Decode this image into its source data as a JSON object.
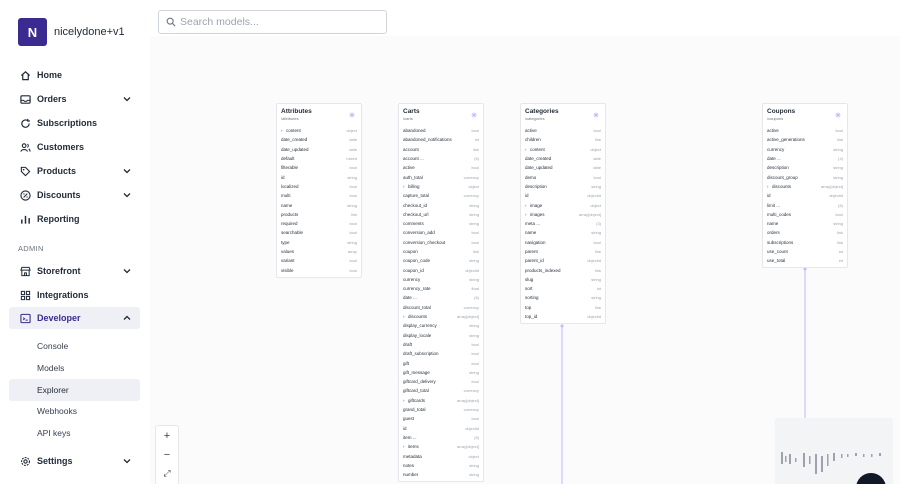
{
  "store": {
    "initial": "N",
    "name": "nicelydone+v1"
  },
  "search": {
    "placeholder": "Search models..."
  },
  "nav": {
    "home": "Home",
    "orders": "Orders",
    "subscriptions": "Subscriptions",
    "customers": "Customers",
    "products": "Products",
    "discounts": "Discounts",
    "reporting": "Reporting",
    "admin_label": "ADMIN",
    "storefront": "Storefront",
    "integrations": "Integrations",
    "developer": "Developer",
    "developer_items": [
      "Console",
      "Models",
      "Explorer",
      "Webhooks",
      "API keys"
    ],
    "settings": "Settings"
  },
  "colors": {
    "brand": "#3b2a8f",
    "link_line": "#c4b5fd"
  },
  "models": [
    {
      "title": "Attributes",
      "path": "/attributes",
      "fields": [
        {
          "name": "content",
          "type": "object",
          "expand": true
        },
        {
          "name": "date_created",
          "type": "date"
        },
        {
          "name": "date_updated",
          "type": "date"
        },
        {
          "name": "default",
          "type": "mixed"
        },
        {
          "name": "filterable",
          "type": "bool"
        },
        {
          "name": "id",
          "type": "string"
        },
        {
          "name": "localized",
          "type": "bool"
        },
        {
          "name": "multi",
          "type": "bool"
        },
        {
          "name": "name",
          "type": "string"
        },
        {
          "name": "products",
          "type": "link"
        },
        {
          "name": "required",
          "type": "bool"
        },
        {
          "name": "searchable",
          "type": "bool"
        },
        {
          "name": "type",
          "type": "string"
        },
        {
          "name": "values",
          "type": "array"
        },
        {
          "name": "variant",
          "type": "bool"
        },
        {
          "name": "visible",
          "type": "bool"
        }
      ]
    },
    {
      "title": "Carts",
      "path": "/carts",
      "fields": [
        {
          "name": "abandoned",
          "type": "bool"
        },
        {
          "name": "abandoned_notifications",
          "type": "int"
        },
        {
          "name": "account",
          "type": "link"
        },
        {
          "name": "account ...",
          "type": "(5)"
        },
        {
          "name": "active",
          "type": "bool"
        },
        {
          "name": "auth_total",
          "type": "currency"
        },
        {
          "name": "billing",
          "type": "object",
          "expand": true
        },
        {
          "name": "capture_total",
          "type": "currency"
        },
        {
          "name": "checkout_id",
          "type": "string"
        },
        {
          "name": "checkout_url",
          "type": "string"
        },
        {
          "name": "comments",
          "type": "string"
        },
        {
          "name": "conversion_add",
          "type": "bool"
        },
        {
          "name": "conversion_checkout",
          "type": "bool"
        },
        {
          "name": "coupon",
          "type": "link"
        },
        {
          "name": "coupon_code",
          "type": "string"
        },
        {
          "name": "coupon_id",
          "type": "objectid"
        },
        {
          "name": "currency",
          "type": "string"
        },
        {
          "name": "currency_rate",
          "type": "float"
        },
        {
          "name": "date ...",
          "type": "(6)"
        },
        {
          "name": "discount_total",
          "type": "currency"
        },
        {
          "name": "discounts",
          "type": "array[object]",
          "expand": true
        },
        {
          "name": "display_currency",
          "type": "string"
        },
        {
          "name": "display_locale",
          "type": "string"
        },
        {
          "name": "draft",
          "type": "bool"
        },
        {
          "name": "draft_subscription",
          "type": "bool"
        },
        {
          "name": "gift",
          "type": "bool"
        },
        {
          "name": "gift_message",
          "type": "string"
        },
        {
          "name": "giftcard_delivery",
          "type": "bool"
        },
        {
          "name": "giftcard_total",
          "type": "currency"
        },
        {
          "name": "giftcards",
          "type": "array[object]",
          "expand": true
        },
        {
          "name": "grand_total",
          "type": "currency"
        },
        {
          "name": "guest",
          "type": "bool"
        },
        {
          "name": "id",
          "type": "objectid"
        },
        {
          "name": "item ...",
          "type": "(5)"
        },
        {
          "name": "items",
          "type": "array[object]",
          "expand": true
        },
        {
          "name": "metadata",
          "type": "object"
        },
        {
          "name": "notes",
          "type": "string"
        },
        {
          "name": "number",
          "type": "string"
        }
      ]
    },
    {
      "title": "Categories",
      "path": "/categories",
      "fields": [
        {
          "name": "active",
          "type": "bool"
        },
        {
          "name": "children",
          "type": "link"
        },
        {
          "name": "content",
          "type": "object",
          "expand": true
        },
        {
          "name": "date_created",
          "type": "date"
        },
        {
          "name": "date_updated",
          "type": "date"
        },
        {
          "name": "demo",
          "type": "bool"
        },
        {
          "name": "description",
          "type": "string"
        },
        {
          "name": "id",
          "type": "objectid"
        },
        {
          "name": "image",
          "type": "object",
          "expand": true
        },
        {
          "name": "images",
          "type": "array[object]",
          "expand": true
        },
        {
          "name": "meta ...",
          "type": "(3)"
        },
        {
          "name": "name",
          "type": "string"
        },
        {
          "name": "navigation",
          "type": "bool"
        },
        {
          "name": "parent",
          "type": "link"
        },
        {
          "name": "parent_id",
          "type": "objectid"
        },
        {
          "name": "products_indexed",
          "type": "link"
        },
        {
          "name": "slug",
          "type": "string"
        },
        {
          "name": "sort",
          "type": "int"
        },
        {
          "name": "sorting",
          "type": "string"
        },
        {
          "name": "top",
          "type": "link"
        },
        {
          "name": "top_id",
          "type": "objectid"
        }
      ]
    },
    {
      "title": "Coupons",
      "path": "/coupons",
      "fields": [
        {
          "name": "active",
          "type": "bool"
        },
        {
          "name": "active_generations",
          "type": "link"
        },
        {
          "name": "currency",
          "type": "string"
        },
        {
          "name": "date ...",
          "type": "(4)"
        },
        {
          "name": "description",
          "type": "string"
        },
        {
          "name": "discount_group",
          "type": "string"
        },
        {
          "name": "discounts",
          "type": "array[object]",
          "expand": true
        },
        {
          "name": "id",
          "type": "objectid"
        },
        {
          "name": "limit ...",
          "type": "(6)"
        },
        {
          "name": "multi_codes",
          "type": "bool"
        },
        {
          "name": "name",
          "type": "string"
        },
        {
          "name": "orders",
          "type": "link"
        },
        {
          "name": "subscriptions",
          "type": "link"
        },
        {
          "name": "use_count",
          "type": "int"
        },
        {
          "name": "use_total",
          "type": "int"
        }
      ]
    }
  ],
  "zoom": {
    "in": "+",
    "out": "−",
    "fit": "⤢"
  }
}
